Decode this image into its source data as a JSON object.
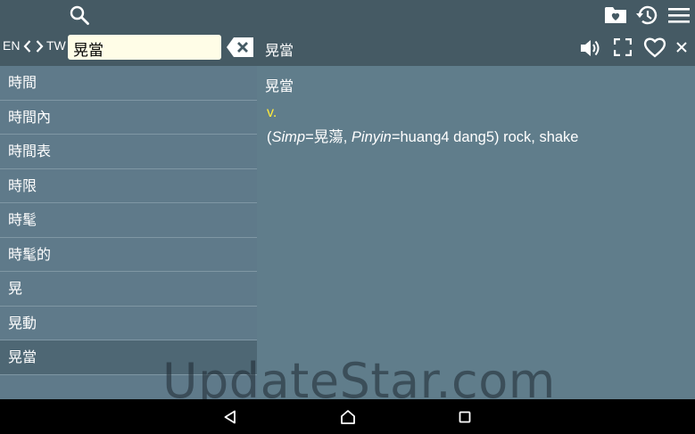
{
  "toolbar": {
    "search_icon": "search-icon",
    "favorites_icon": "folder-heart-icon",
    "history_icon": "history-icon",
    "menu_icon": "menu-icon"
  },
  "search": {
    "lang_from": "EN",
    "lang_to": "TW",
    "query": "晃當"
  },
  "detail_bar": {
    "title": "晃當"
  },
  "list": {
    "items": [
      "時間",
      "時間內",
      "時間表",
      "時限",
      "時髦",
      "時髦的",
      "晃",
      "晃動",
      "晃當"
    ],
    "selected_index": 8
  },
  "entry": {
    "headword": "晃當",
    "pos": "v.",
    "def_open": "(",
    "simp_label": "Simp",
    "simp_value": "=晃蕩, ",
    "pinyin_label": "Pinyin",
    "pinyin_value": "=huang4 dang5) rock, shake"
  },
  "watermark": "UpdateStar.com",
  "colors": {
    "toolbar": "#455a64",
    "content": "#607d8b",
    "selected": "#4e6774",
    "pos": "#ffeb3b"
  }
}
